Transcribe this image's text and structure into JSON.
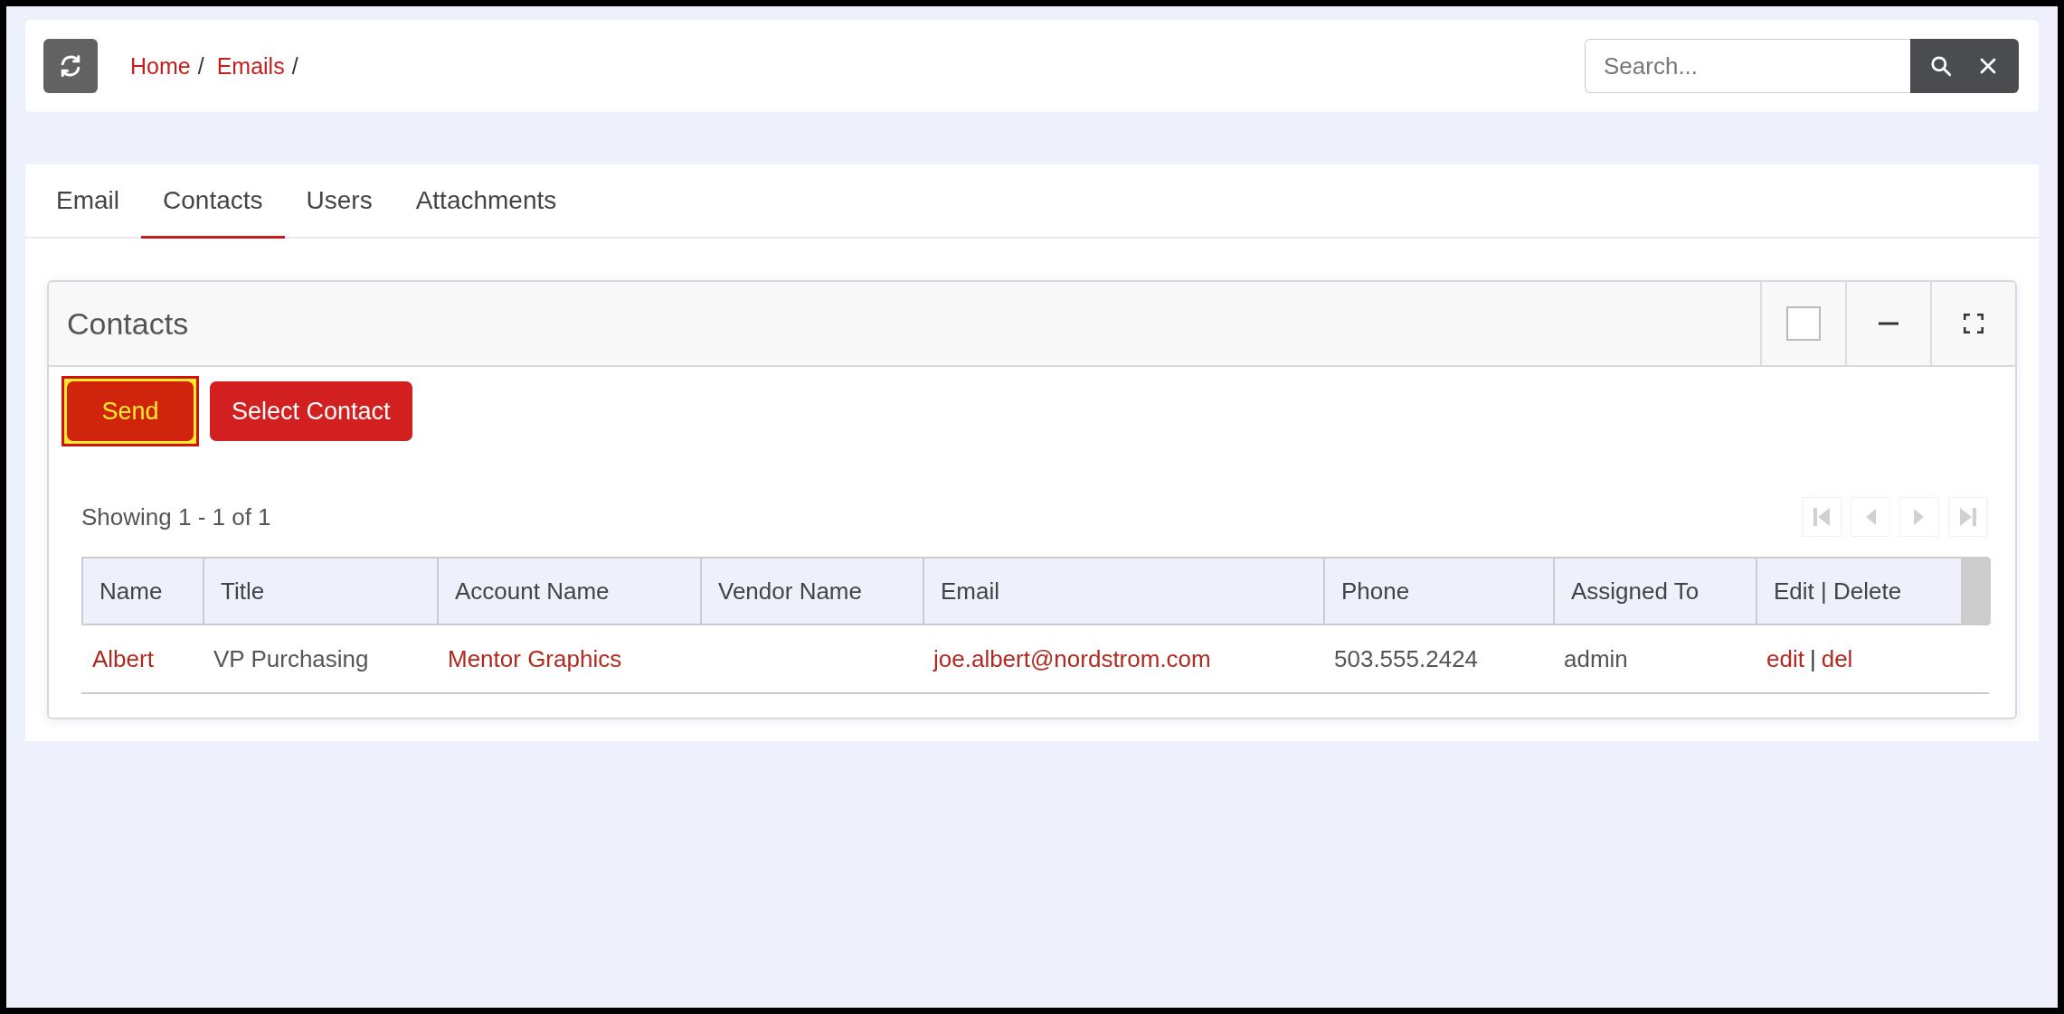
{
  "breadcrumb": [
    {
      "label": "Home",
      "separator": "/"
    },
    {
      "label": "Emails",
      "separator": "/"
    }
  ],
  "search": {
    "placeholder": "Search..."
  },
  "tabs": [
    {
      "label": "Email",
      "selected": false
    },
    {
      "label": "Contacts",
      "selected": true
    },
    {
      "label": "Users",
      "selected": false
    },
    {
      "label": "Attachments",
      "selected": false
    }
  ],
  "panel": {
    "title": "Contacts",
    "checked": false
  },
  "buttons": [
    {
      "label": "Send",
      "highlighted": true
    },
    {
      "label": "Select Contact",
      "highlighted": false
    }
  ],
  "summary": "Showing 1 - 1 of 1",
  "pagination": [
    {
      "kind": "first",
      "disabled": true
    },
    {
      "kind": "prev",
      "disabled": true
    },
    {
      "kind": "next",
      "disabled": true
    },
    {
      "kind": "last",
      "disabled": true
    }
  ],
  "table": {
    "columns": [
      "Name",
      "Title",
      "Account Name",
      "Vendor Name",
      "Email",
      "Phone",
      "Assigned To",
      "Edit | Delete"
    ],
    "rows": [
      {
        "cells": [
          {
            "kind": "link",
            "text": "Albert"
          },
          {
            "kind": "text",
            "text": "VP Purchasing"
          },
          {
            "kind": "link",
            "text": "Mentor Graphics"
          },
          {
            "kind": "empty"
          },
          {
            "kind": "link",
            "text": "joe.albert@nordstrom.com"
          },
          {
            "kind": "text",
            "text": "503.555.2424"
          },
          {
            "kind": "text",
            "text": "admin"
          },
          {
            "kind": "actions",
            "actions": [
              "edit",
              "del"
            ],
            "separator": "|"
          }
        ]
      }
    ]
  }
}
